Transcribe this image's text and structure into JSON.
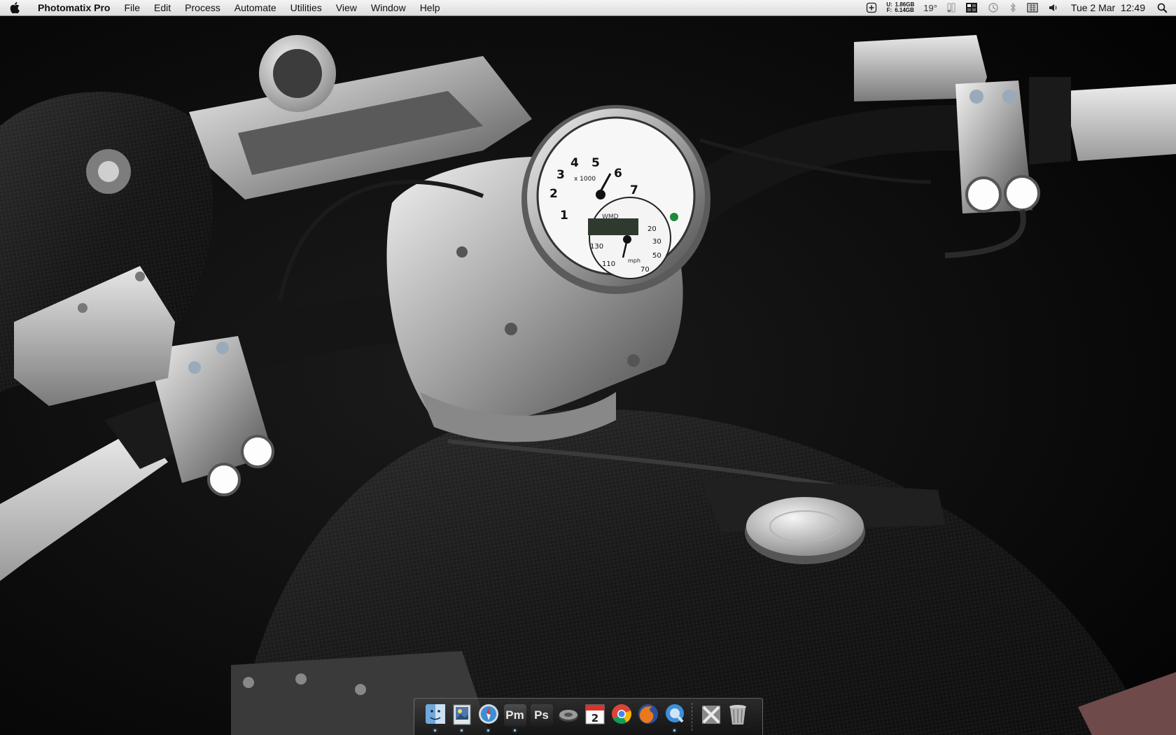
{
  "menubar": {
    "apple_icon": "apple-icon",
    "app_name": "Photomatix Pro",
    "menus": [
      "File",
      "Edit",
      "Process",
      "Automate",
      "Utilities",
      "View",
      "Window",
      "Help"
    ],
    "status": {
      "mem_used_label": "U:",
      "mem_used": "1.86GB",
      "mem_free_label": "F:",
      "mem_free": "6.14GB",
      "temperature": "19°",
      "clock": "Tue 2 Mar  12:49"
    }
  },
  "dock": {
    "items": [
      {
        "name": "Finder",
        "icon": "finder-icon",
        "running": true
      },
      {
        "name": "Preview",
        "icon": "preview-icon",
        "running": true
      },
      {
        "name": "Safari",
        "icon": "safari-icon",
        "running": true
      },
      {
        "name": "Photomatix Pro",
        "label": "Pm",
        "running": true
      },
      {
        "name": "Photoshop",
        "label": "Ps",
        "running": false
      },
      {
        "name": "Speaker",
        "icon": "speaker-icon",
        "running": false
      },
      {
        "name": "iCal",
        "icon": "calendar-icon",
        "date": "2",
        "running": false
      },
      {
        "name": "Chrome",
        "icon": "chrome-icon",
        "running": false
      },
      {
        "name": "Firefox",
        "icon": "firefox-icon",
        "running": false
      },
      {
        "name": "QuickTime",
        "icon": "quicktime-icon",
        "running": true
      },
      {
        "name": "Applications",
        "icon": "stack-icon",
        "running": false
      },
      {
        "name": "Trash",
        "icon": "trash-icon",
        "running": false
      }
    ]
  },
  "wallpaper": {
    "subject": "motorcycle-handlebar-wallpaper",
    "gauge_label": "x 1000",
    "gauge_numbers": [
      "1",
      "2",
      "3",
      "4",
      "5",
      "6",
      "7"
    ],
    "speed_numbers": [
      "20",
      "30",
      "50",
      "70",
      "110",
      "130"
    ],
    "gauge_brand": "WMD",
    "speed_unit": "mph"
  }
}
